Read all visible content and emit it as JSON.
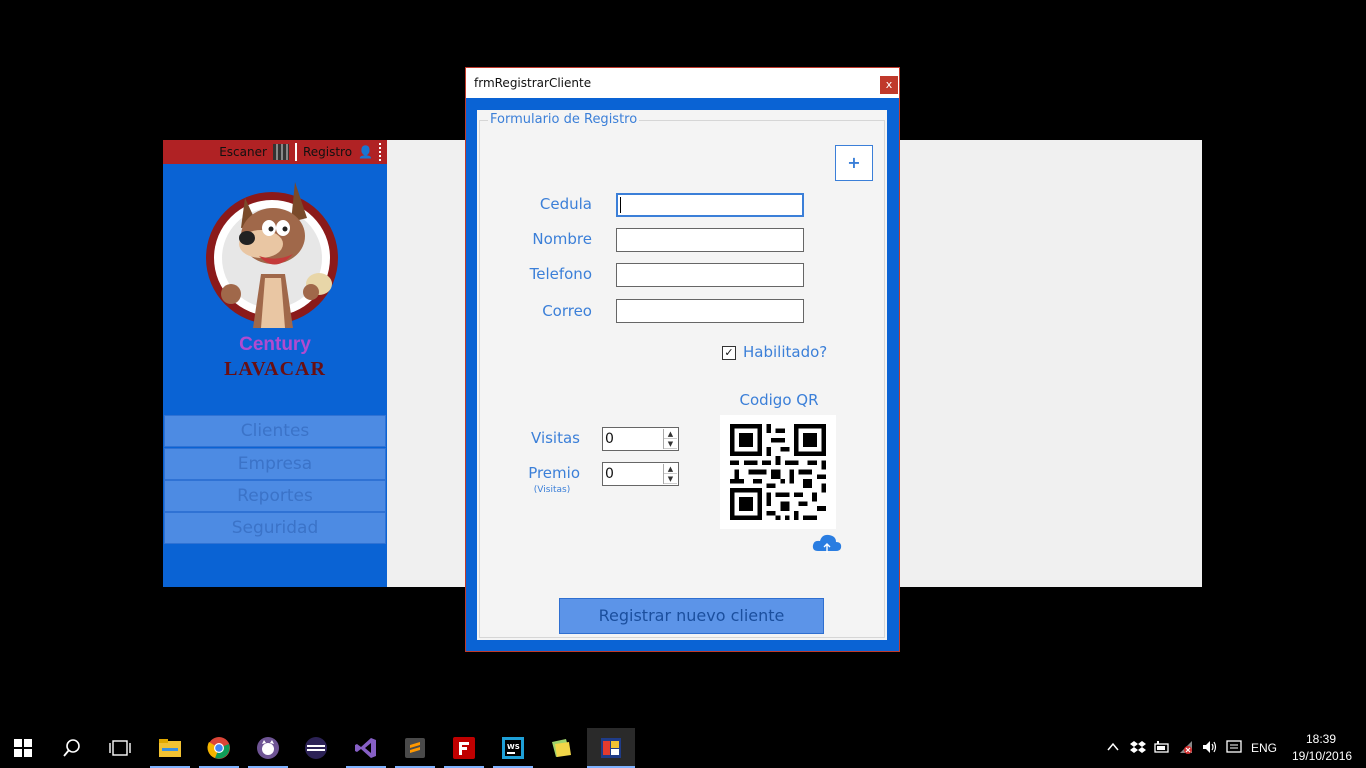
{
  "app": {
    "topbar": {
      "scan_label": "Escaner",
      "register_label": "Registro"
    },
    "logo": {
      "line1": "Century",
      "line2": "LAVACAR"
    },
    "sidebar_items": [
      "Clientes",
      "Empresa",
      "Reportes",
      "Seguridad"
    ]
  },
  "dialog": {
    "title": "frmRegistrarCliente",
    "close_glyph": "x",
    "group_title": "Formulario de Registro",
    "add_glyph": "+",
    "fields": {
      "cedula": {
        "label": "Cedula",
        "value": ""
      },
      "nombre": {
        "label": "Nombre",
        "value": ""
      },
      "telefono": {
        "label": "Telefono",
        "value": ""
      },
      "correo": {
        "label": "Correo",
        "value": ""
      }
    },
    "habilitado": {
      "label": "Habilitado?",
      "checked": true,
      "check_glyph": "✓"
    },
    "qr_label": "Codigo QR",
    "visitas": {
      "label": "Visitas",
      "value": "0"
    },
    "premio": {
      "label": "Premio",
      "sublabel": "(Visitas)",
      "value": "0"
    },
    "register_button": "Registrar nuevo cliente"
  },
  "taskbar": {
    "apps": [
      "start-icon",
      "search-icon",
      "task-view-icon",
      "file-explorer-icon",
      "chrome-icon",
      "github-icon",
      "eclipse-icon",
      "visual-studio-icon",
      "sublime-icon",
      "filezilla-icon",
      "webstorm-icon",
      "photos-icon",
      "running-app-icon"
    ],
    "tray": {
      "language": "ENG",
      "time": "18:39",
      "date": "19/10/2016"
    }
  },
  "colors": {
    "accent": "#0a63d4",
    "label": "#3b7fd8",
    "topbar": "#b02224"
  }
}
